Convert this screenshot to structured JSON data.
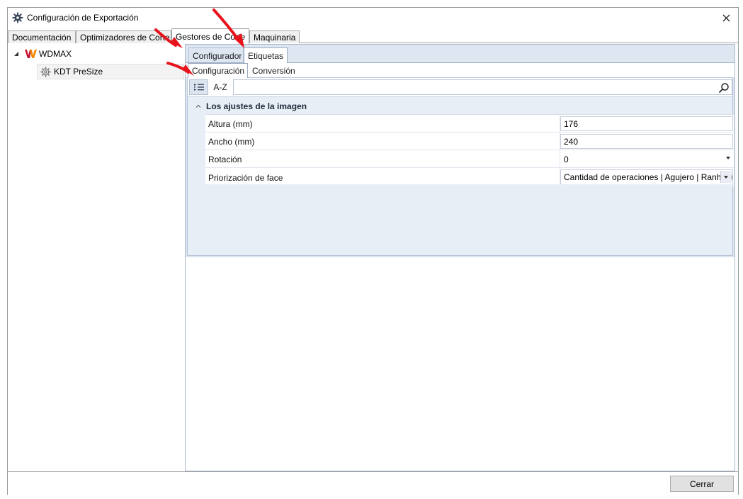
{
  "window": {
    "title": "Configuración de Exportación",
    "close_glyph": "✕"
  },
  "top_tabs": [
    {
      "label": "Documentación",
      "active": false
    },
    {
      "label": "Optimizadores de Corte",
      "active": false
    },
    {
      "label": "Gestores de Corte",
      "active": true
    },
    {
      "label": "Maquinaria",
      "active": false
    }
  ],
  "tree": {
    "root": {
      "label": "WDMAX",
      "icon": "wdmax-logo-icon",
      "expanded": true
    },
    "child": {
      "label": "KDT PreSize",
      "icon": "gear-icon",
      "selected": true
    }
  },
  "sub_tabs_1": [
    {
      "label": "Configurador",
      "active": false
    },
    {
      "label": "Etiquetas",
      "active": true
    }
  ],
  "sub_tabs_2": [
    {
      "label": "Configuración",
      "active": true
    },
    {
      "label": "Conversión",
      "active": false
    }
  ],
  "toolbar": {
    "categorized_icon": "categorized-list-icon",
    "alpha_label": "A-Z",
    "search_placeholder": "",
    "search_icon": "search-icon"
  },
  "category": {
    "label": "Los ajustes de la imagen",
    "expanded": true
  },
  "properties": [
    {
      "name": "Altura (mm)",
      "value": "176",
      "type": "text"
    },
    {
      "name": "Ancho (mm)",
      "value": "240",
      "type": "text"
    },
    {
      "name": "Rotación",
      "value": "0",
      "type": "select"
    },
    {
      "name": "Priorización de face",
      "value": "Cantidad de operaciones | Agujero | Ranhura",
      "type": "select-button"
    }
  ],
  "footer": {
    "close_label": "Cerrar"
  },
  "colors": {
    "accent_arrow": "#e8141c",
    "panel_blue": "#dde6f1",
    "wdmax_red": "#c8102e",
    "wdmax_orange": "#f08a00"
  }
}
